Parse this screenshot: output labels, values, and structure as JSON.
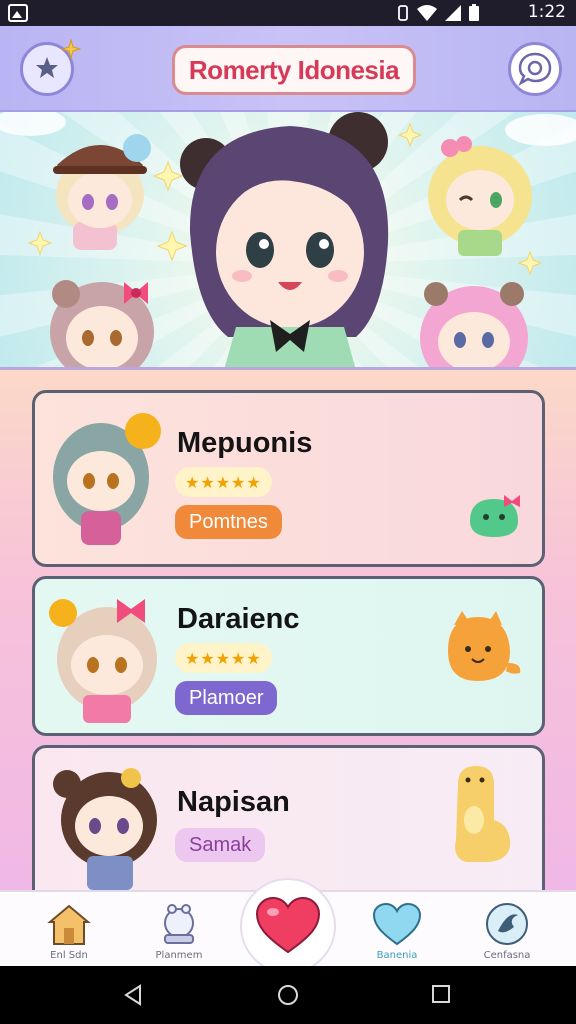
{
  "status_bar": {
    "time": "1:22"
  },
  "header": {
    "title": "Romerty Idonesia"
  },
  "cards": [
    {
      "name": "Mepuonis",
      "stars": "★★★★★",
      "tag": "Pomtnes",
      "tag_color": "#f08a3a"
    },
    {
      "name": "Daraienc",
      "stars": "★★★★★",
      "tag": "Plamoer",
      "tag_color": "#7e68cf"
    },
    {
      "name": "Napisan",
      "tag": "Samak",
      "tag_color": "#ecc8f0"
    }
  ],
  "bottom_nav": {
    "items": [
      {
        "label": "Enl Sdn",
        "icon": "home-icon"
      },
      {
        "label": "Planmem",
        "icon": "crystal-ball-icon"
      },
      {
        "label": "",
        "icon": "heart-icon"
      },
      {
        "label": "Banenia",
        "icon": "heart-outline-icon"
      },
      {
        "label": "Cenfasna",
        "icon": "swirl-icon"
      }
    ]
  },
  "colors": {
    "accent": "#d63a58",
    "header": "#c0baf5",
    "card_border": "#5b6172"
  }
}
